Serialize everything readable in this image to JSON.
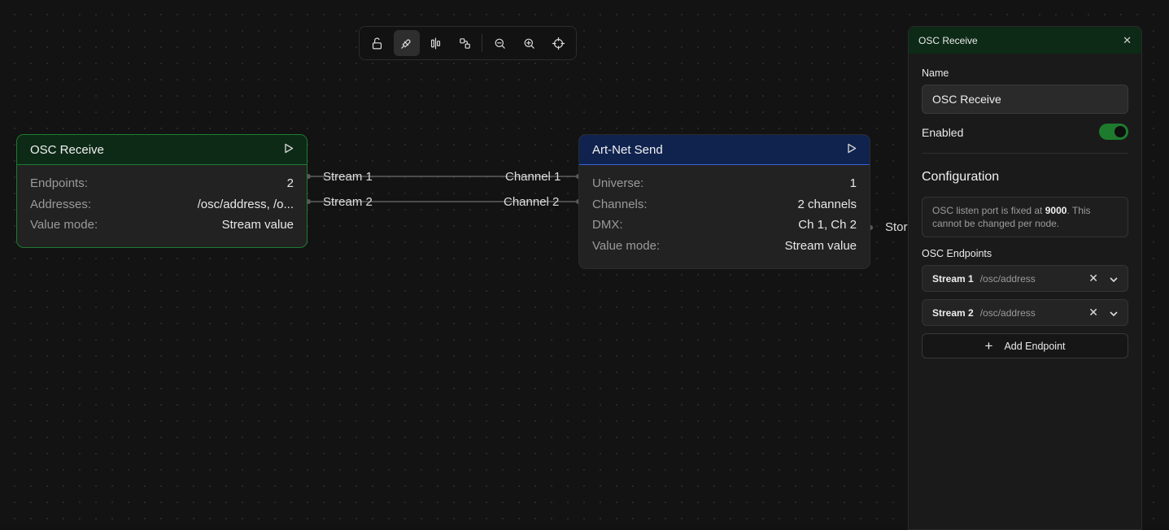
{
  "toolbar": {
    "icons": [
      "unlock-icon",
      "snap-icon",
      "align-icon",
      "layout-icon",
      "zoom-out-icon",
      "zoom-in-icon",
      "fit-view-icon"
    ],
    "active": "snap-icon"
  },
  "colors": {
    "accent_green": "#1e7b2e",
    "node_green_header": "#0d2a16",
    "node_blue_header": "#10234f",
    "canvas_bg": "#131313"
  },
  "nodes": {
    "osc": {
      "title": "OSC Receive",
      "rows": [
        {
          "key": "Endpoints:",
          "value": "2"
        },
        {
          "key": "Addresses:",
          "value": "/osc/address, /o..."
        },
        {
          "key": "Value mode:",
          "value": "Stream value"
        }
      ],
      "outputs": [
        "Stream 1",
        "Stream 2"
      ]
    },
    "artnet": {
      "title": "Art-Net Send",
      "rows": [
        {
          "key": "Universe:",
          "value": "1"
        },
        {
          "key": "Channels:",
          "value": "2 channels"
        },
        {
          "key": "DMX:",
          "value": "Ch 1, Ch 2"
        },
        {
          "key": "Value mode:",
          "value": "Stream value"
        }
      ],
      "inputs": [
        "Channel 1",
        "Channel 2"
      ],
      "output_cut": "Stor"
    }
  },
  "panel": {
    "title": "OSC Receive",
    "name_label": "Name",
    "name_value": "OSC Receive",
    "enabled_label": "Enabled",
    "enabled": true,
    "config_title": "Configuration",
    "info_prefix": "OSC listen port is fixed at ",
    "info_port": "9000",
    "info_suffix": ". This cannot be changed per node.",
    "endpoints_label": "OSC Endpoints",
    "endpoints": [
      {
        "name": "Stream 1",
        "address": "/osc/address"
      },
      {
        "name": "Stream 2",
        "address": "/osc/address"
      }
    ],
    "add_label": "Add Endpoint"
  }
}
